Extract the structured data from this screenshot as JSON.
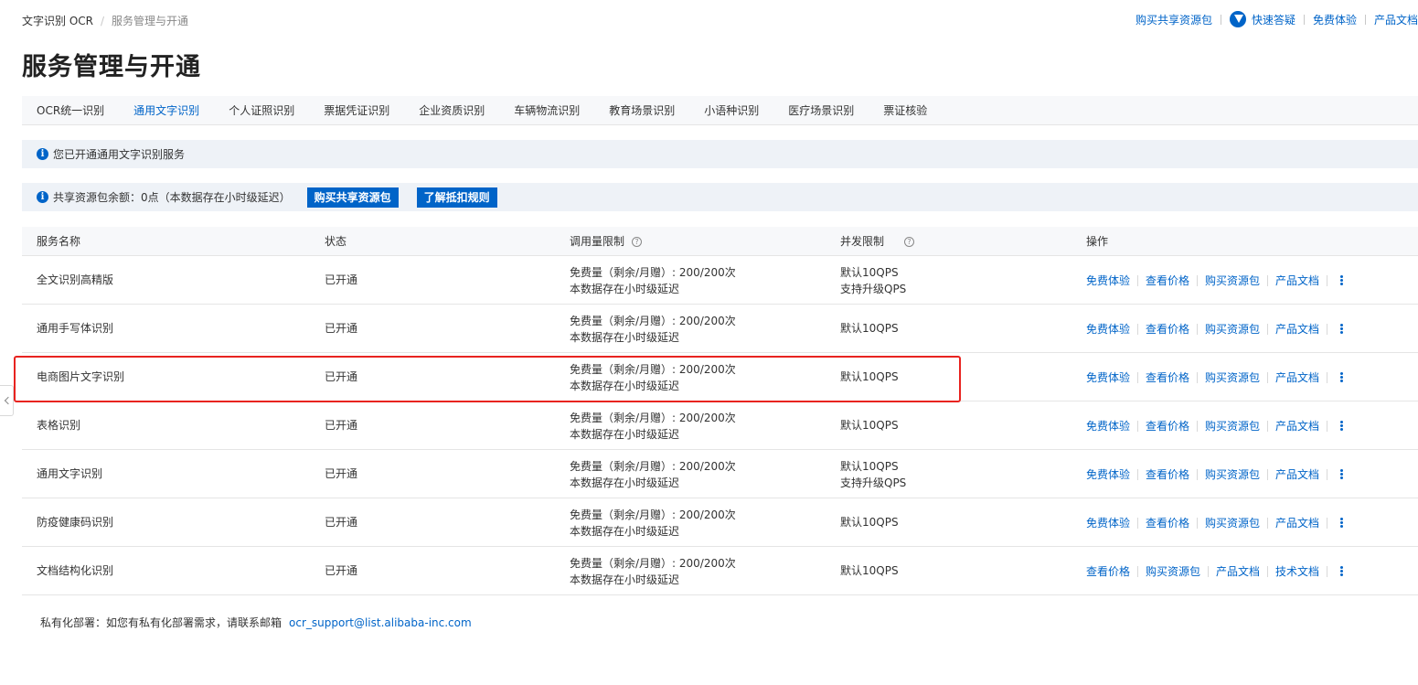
{
  "breadcrumb": {
    "root": "文字识别 OCR",
    "separator": "/",
    "current": "服务管理与开通"
  },
  "toplinks": {
    "buy_shared_pack": "购买共享资源包",
    "quick_qa": "快速答疑",
    "free_trial": "免费体验",
    "product_docs": "产品文档"
  },
  "page_title": "服务管理与开通",
  "tabs": [
    {
      "label": "OCR统一识别",
      "active": false
    },
    {
      "label": "通用文字识别",
      "active": true
    },
    {
      "label": "个人证照识别",
      "active": false
    },
    {
      "label": "票据凭证识别",
      "active": false
    },
    {
      "label": "企业资质识别",
      "active": false
    },
    {
      "label": "车辆物流识别",
      "active": false
    },
    {
      "label": "教育场景识别",
      "active": false
    },
    {
      "label": "小语种识别",
      "active": false
    },
    {
      "label": "医疗场景识别",
      "active": false
    },
    {
      "label": "票证核验",
      "active": false
    }
  ],
  "notices": {
    "activated": "您已开通通用文字识别服务",
    "balance": "共享资源包余额：0点（本数据存在小时级延迟）",
    "buy_button": "购买共享资源包",
    "rules_button": "了解抵扣规则"
  },
  "table": {
    "headers": {
      "name": "服务名称",
      "status": "状态",
      "quota": "调用量限制",
      "concurrency": "并发限制",
      "ops": "操作"
    },
    "rows": [
      {
        "name": "全文识别高精版",
        "status": "已开通",
        "quota_line1": "免费量（剩余/月赠）: 200/200次",
        "quota_line2": "本数据存在小时级延迟",
        "conc_line1": "默认10QPS",
        "conc_line2": "支持升级QPS",
        "ops": [
          "免费体验",
          "查看价格",
          "购买资源包",
          "产品文档"
        ]
      },
      {
        "name": "通用手写体识别",
        "status": "已开通",
        "quota_line1": "免费量（剩余/月赠）: 200/200次",
        "quota_line2": "本数据存在小时级延迟",
        "conc_line1": "默认10QPS",
        "conc_line2": "",
        "ops": [
          "免费体验",
          "查看价格",
          "购买资源包",
          "产品文档"
        ]
      },
      {
        "name": "电商图片文字识别",
        "status": "已开通",
        "quota_line1": "免费量（剩余/月赠）: 200/200次",
        "quota_line2": "本数据存在小时级延迟",
        "conc_line1": "默认10QPS",
        "conc_line2": "",
        "ops": [
          "免费体验",
          "查看价格",
          "购买资源包",
          "产品文档"
        ]
      },
      {
        "name": "表格识别",
        "status": "已开通",
        "quota_line1": "免费量（剩余/月赠）: 200/200次",
        "quota_line2": "本数据存在小时级延迟",
        "conc_line1": "默认10QPS",
        "conc_line2": "",
        "ops": [
          "免费体验",
          "查看价格",
          "购买资源包",
          "产品文档"
        ]
      },
      {
        "name": "通用文字识别",
        "status": "已开通",
        "quota_line1": "免费量（剩余/月赠）: 200/200次",
        "quota_line2": "本数据存在小时级延迟",
        "conc_line1": "默认10QPS",
        "conc_line2": "支持升级QPS",
        "ops": [
          "免费体验",
          "查看价格",
          "购买资源包",
          "产品文档"
        ]
      },
      {
        "name": "防疫健康码识别",
        "status": "已开通",
        "quota_line1": "免费量（剩余/月赠）: 200/200次",
        "quota_line2": "本数据存在小时级延迟",
        "conc_line1": "默认10QPS",
        "conc_line2": "",
        "ops": [
          "免费体验",
          "查看价格",
          "购买资源包",
          "产品文档"
        ]
      },
      {
        "name": "文档结构化识别",
        "status": "已开通",
        "quota_line1": "免费量（剩余/月赠）: 200/200次",
        "quota_line2": "本数据存在小时级延迟",
        "conc_line1": "默认10QPS",
        "conc_line2": "",
        "ops": [
          "查看价格",
          "购买资源包",
          "产品文档",
          "技术文档"
        ]
      }
    ]
  },
  "footer": {
    "text": "私有化部署：如您有私有化部署需求，请联系邮箱",
    "email": "ocr_support@list.alibaba-inc.com"
  },
  "colors": {
    "link": "#0064c8",
    "highlight": "#e8231f",
    "header_bg": "#f7f8fa",
    "notice_bg": "#eef2f7"
  }
}
